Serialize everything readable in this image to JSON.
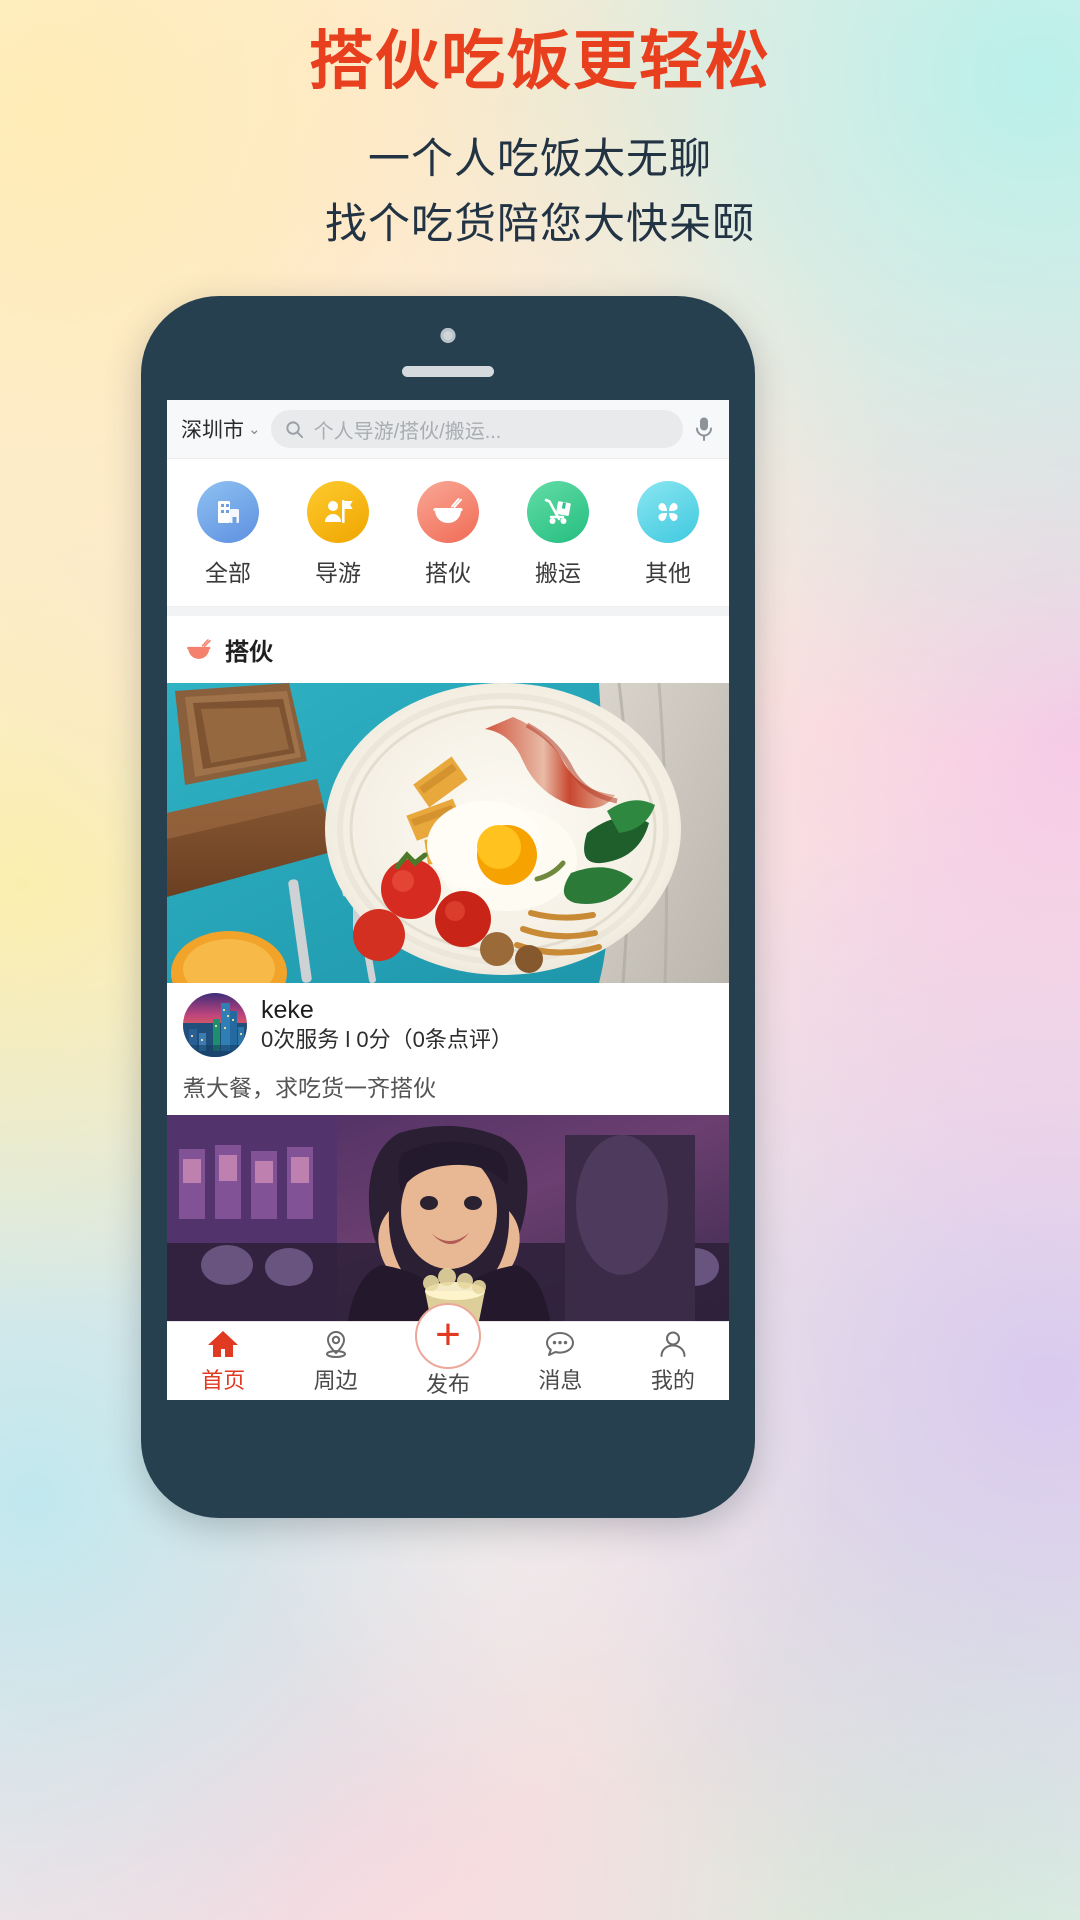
{
  "promo": {
    "headline": "搭伙吃饭更轻松",
    "sub_line1": "一个人吃饭太无聊",
    "sub_line2": "找个吃货陪您大快朵颐",
    "headline_color": "#e8401f",
    "sub_color": "#223344"
  },
  "search": {
    "city": "深圳市",
    "chevron": "⌄",
    "placeholder": "个人导游/搭伙/搬运...",
    "search_icon": "search-icon",
    "mic_icon": "microphone-icon"
  },
  "categories": [
    {
      "label": "全部",
      "icon": "buildings-icon",
      "color": "#6fa8e8"
    },
    {
      "label": "导游",
      "icon": "guide-flag-icon",
      "color": "#f7b500"
    },
    {
      "label": "搭伙",
      "icon": "rice-bowl-icon",
      "color": "#f4806e"
    },
    {
      "label": "搬运",
      "icon": "hand-truck-icon",
      "color": "#3ecf8e"
    },
    {
      "label": "其他",
      "icon": "clover-grid-icon",
      "color": "#5fd5e8"
    }
  ],
  "section": {
    "title": "搭伙",
    "icon": "rice-bowl-icon",
    "icon_color": "#f4806e"
  },
  "post": {
    "username": "keke",
    "stats": "0次服务 l 0分（0条点评）",
    "caption": "煮大餐，求吃货一齐搭伙",
    "avatar_alt": "city-skyline-avatar",
    "photo_alt": "breakfast-plate-photo"
  },
  "post2": {
    "photo_alt": "woman-at-restaurant-photo"
  },
  "tabbar": [
    {
      "label": "首页",
      "icon": "home-icon",
      "active": true
    },
    {
      "label": "周边",
      "icon": "location-pin-icon",
      "active": false
    },
    {
      "label": "发布",
      "icon": "plus-circle-icon",
      "active": false
    },
    {
      "label": "消息",
      "icon": "chat-bubble-icon",
      "active": false
    },
    {
      "label": "我的",
      "icon": "person-icon",
      "active": false
    }
  ],
  "theme": {
    "accent": "#e03a22",
    "phone_body": "#27404f"
  }
}
